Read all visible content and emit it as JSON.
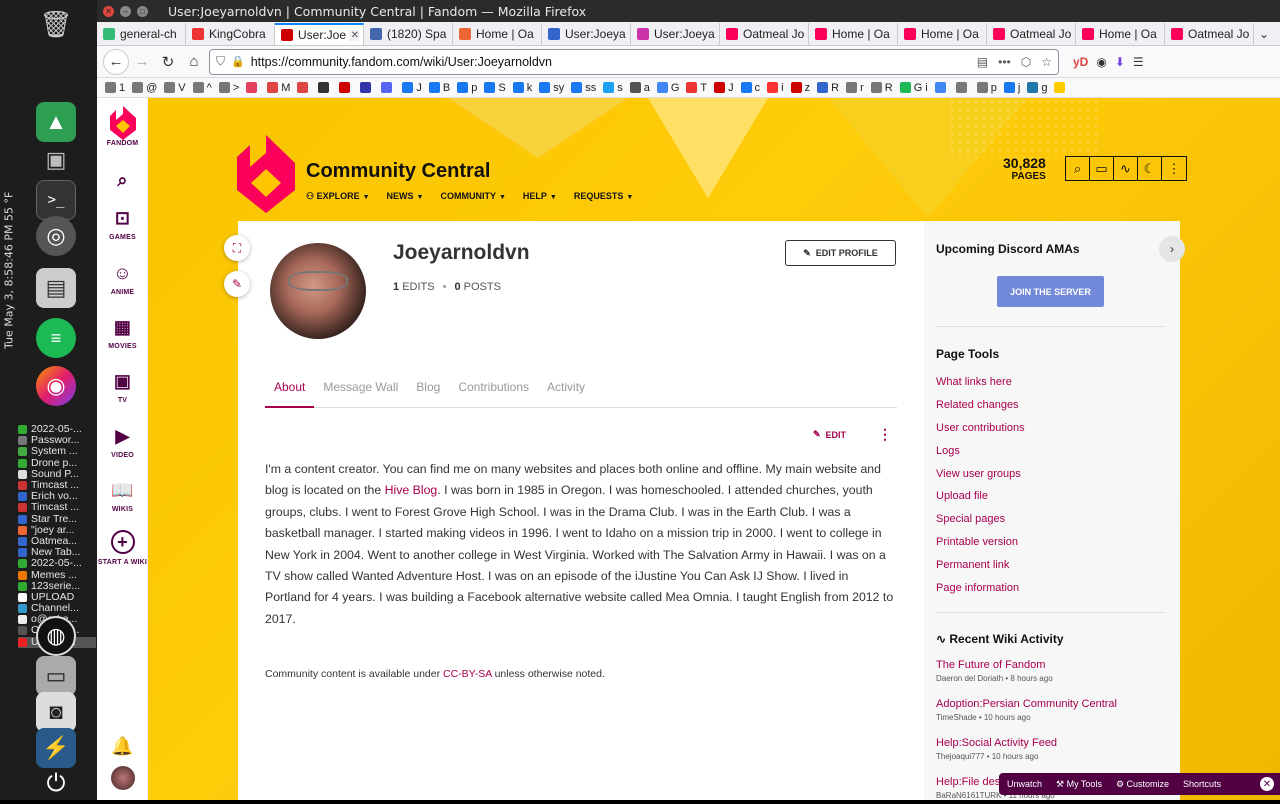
{
  "desktop": {
    "clock": "Tue May 3,  8:58:46 PM   55 °F",
    "taskbar": [
      "2022-05-...",
      "Passwor...",
      "System ...",
      "Drone p...",
      "Sound P...",
      "Timcast ...",
      "Erich vo...",
      "Timcast ...",
      "Star Tre...",
      "\"joey ar...",
      "Oatmea...",
      "New Tab...",
      "2022-05-...",
      "Memes ...",
      "123serie...",
      "UPLOAD",
      "Channel...",
      "o@o-Le...",
      "OBS 25....",
      "User:Jo..."
    ]
  },
  "browser": {
    "window_title": "User:Joeyarnoldvn | Community Central | Fandom — Mozilla Firefox",
    "tabs": [
      "general-ch",
      "KingCobra",
      "User:Joe",
      "(1820) Spa",
      "Home | Oa",
      "User:Joeya",
      "User:Joeya",
      "Oatmeal Jo",
      "Home | Oa",
      "Home | Oa",
      "Oatmeal Jo",
      "Home | Oa",
      "Oatmeal Jo"
    ],
    "url": "https://community.fandom.com/wiki/User:Joeyarnoldvn",
    "bookmarks": [
      "1",
      "@",
      "V",
      "^",
      ">",
      "",
      "M",
      "",
      "",
      "",
      "",
      "",
      "J",
      "B",
      "p",
      "S",
      "k",
      "sy",
      "ss",
      "s",
      "a",
      "G",
      "T",
      "J",
      "c",
      "i",
      "z",
      "R",
      "r",
      "R",
      "G i",
      "",
      "",
      "p",
      "j",
      "g",
      ""
    ]
  },
  "fandom_rail": {
    "brand": "FANDOM",
    "games": "GAMES",
    "anime": "ANIME",
    "movies": "MOVIES",
    "tv": "TV",
    "video": "VIDEO",
    "wikis": "WIKIS",
    "start_a_wiki": "START A WIKI"
  },
  "wiki": {
    "name": "Community Central",
    "nav": [
      "EXPLORE",
      "NEWS",
      "COMMUNITY",
      "HELP",
      "REQUESTS"
    ],
    "pages_count": "30,828",
    "pages_label": "PAGES"
  },
  "profile": {
    "username": "Joeyarnoldvn",
    "edits_count": "1",
    "edits_label": "EDITS",
    "posts_count": "0",
    "posts_label": "POSTS",
    "edit_profile": "EDIT PROFILE",
    "tabs": [
      "About",
      "Message Wall",
      "Blog",
      "Contributions",
      "Activity"
    ],
    "edit_label": "EDIT",
    "bio_before_link": "I'm a content creator. You can find me on many websites and places both online and offline. My main website and blog is located on the ",
    "bio_link": "Hive Blog",
    "bio_after_link": ". I was born in 1985 in Oregon. I was homeschooled. I attended churches, youth groups, clubs. I went to Forest Grove High School. I was in the Drama Club. I was in the Earth Club. I was a basketball manager. I started making videos in 1996. I went to Idaho on a mission trip in 2000. I went to college in New York in 2004. Went to another college in West Virginia. Worked with The Salvation Army in Hawaii. I was on a TV show called Wanted Adventure Host. I was on an episode of the iJustine You Can Ask IJ Show. I lived in Portland for 4 years. I was building a Facebook alternative website called Mea Omnia. I taught English from 2012 to 2017.",
    "license_before": "Community content is available under ",
    "license_link": "CC-BY-SA",
    "license_after": " unless otherwise noted."
  },
  "sidebar": {
    "discord_heading": "Upcoming Discord AMAs",
    "join_button": "JOIN THE SERVER",
    "page_tools_heading": "Page Tools",
    "page_tools": [
      "What links here",
      "Related changes",
      "User contributions",
      "Logs",
      "View user groups",
      "Upload file",
      "Special pages",
      "Printable version",
      "Permanent link",
      "Page information"
    ],
    "recent_heading": "Recent Wiki Activity",
    "recent": [
      {
        "title": "The Future of Fandom",
        "meta": "Daeron del Doriath • 8 hours ago"
      },
      {
        "title": "Adoption:Persian Community Central",
        "meta": "TimeShade • 10 hours ago"
      },
      {
        "title": "Help:Social Activity Feed",
        "meta": "Thejoaqui777 • 10 hours ago"
      },
      {
        "title": "Help:File des",
        "meta": "BaRaN6161TURK • 11 hours ago"
      }
    ]
  },
  "footer_bar": {
    "unwatch": "Unwatch",
    "my_tools": "My Tools",
    "customize": "Customize",
    "shortcuts": "Shortcuts"
  },
  "colors": {
    "fandom_accent": "#a7004f",
    "fandom_dark": "#520044",
    "wiki_bg": "#f4c20d",
    "discord": "#7289da"
  }
}
